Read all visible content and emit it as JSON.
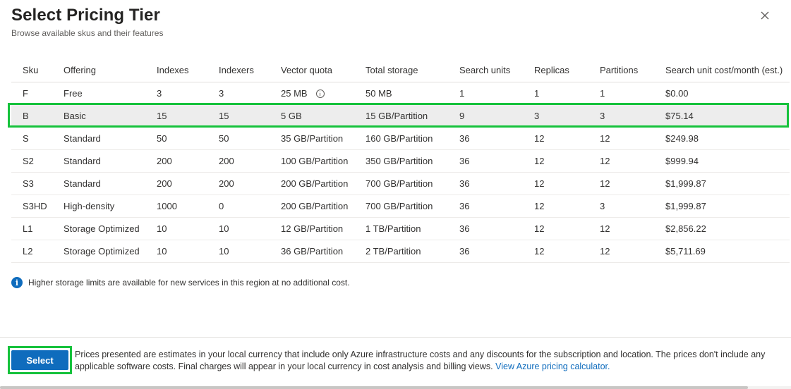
{
  "dialog": {
    "title": "Select Pricing Tier",
    "subtitle": "Browse available skus and their features"
  },
  "table": {
    "headers": [
      "Sku",
      "Offering",
      "Indexes",
      "Indexers",
      "Vector quota",
      "Total storage",
      "Search units",
      "Replicas",
      "Partitions",
      "Search unit cost/month (est.)"
    ],
    "rows": [
      {
        "sku": "F",
        "offering": "Free",
        "indexes": "3",
        "indexers": "3",
        "vector_quota": "25 MB",
        "total_storage": "50 MB",
        "search_units": "1",
        "replicas": "1",
        "partitions": "1",
        "cost": "$0.00"
      },
      {
        "sku": "B",
        "offering": "Basic",
        "indexes": "15",
        "indexers": "15",
        "vector_quota": "5 GB",
        "total_storage": "15 GB/Partition",
        "search_units": "9",
        "replicas": "3",
        "partitions": "3",
        "cost": "$75.14"
      },
      {
        "sku": "S",
        "offering": "Standard",
        "indexes": "50",
        "indexers": "50",
        "vector_quota": "35 GB/Partition",
        "total_storage": "160 GB/Partition",
        "search_units": "36",
        "replicas": "12",
        "partitions": "12",
        "cost": "$249.98"
      },
      {
        "sku": "S2",
        "offering": "Standard",
        "indexes": "200",
        "indexers": "200",
        "vector_quota": "100 GB/Partition",
        "total_storage": "350 GB/Partition",
        "search_units": "36",
        "replicas": "12",
        "partitions": "12",
        "cost": "$999.94"
      },
      {
        "sku": "S3",
        "offering": "Standard",
        "indexes": "200",
        "indexers": "200",
        "vector_quota": "200 GB/Partition",
        "total_storage": "700 GB/Partition",
        "search_units": "36",
        "replicas": "12",
        "partitions": "12",
        "cost": "$1,999.87"
      },
      {
        "sku": "S3HD",
        "offering": "High-density",
        "indexes": "1000",
        "indexers": "0",
        "vector_quota": "200 GB/Partition",
        "total_storage": "700 GB/Partition",
        "search_units": "36",
        "replicas": "12",
        "partitions": "3",
        "cost": "$1,999.87"
      },
      {
        "sku": "L1",
        "offering": "Storage Optimized",
        "indexes": "10",
        "indexers": "10",
        "vector_quota": "12 GB/Partition",
        "total_storage": "1 TB/Partition",
        "search_units": "36",
        "replicas": "12",
        "partitions": "12",
        "cost": "$2,856.22"
      },
      {
        "sku": "L2",
        "offering": "Storage Optimized",
        "indexes": "10",
        "indexers": "10",
        "vector_quota": "36 GB/Partition",
        "total_storage": "2 TB/Partition",
        "search_units": "36",
        "replicas": "12",
        "partitions": "12",
        "cost": "$5,711.69"
      }
    ],
    "selected_sku": "B"
  },
  "notice": {
    "icon": "info-icon",
    "text": "Higher storage limits are available for new services in this region at no additional cost."
  },
  "footer": {
    "select_label": "Select",
    "text": "Prices presented are estimates in your local currency that include only Azure infrastructure costs and any discounts for the subscription and location. The prices don't include any applicable software costs. Final charges will appear in your local currency in cost analysis and billing views.",
    "link_text": "View Azure pricing calculator."
  },
  "colors": {
    "accent": "#0f6cbd",
    "highlight": "#16c23c",
    "selected_row": "#ededed"
  }
}
